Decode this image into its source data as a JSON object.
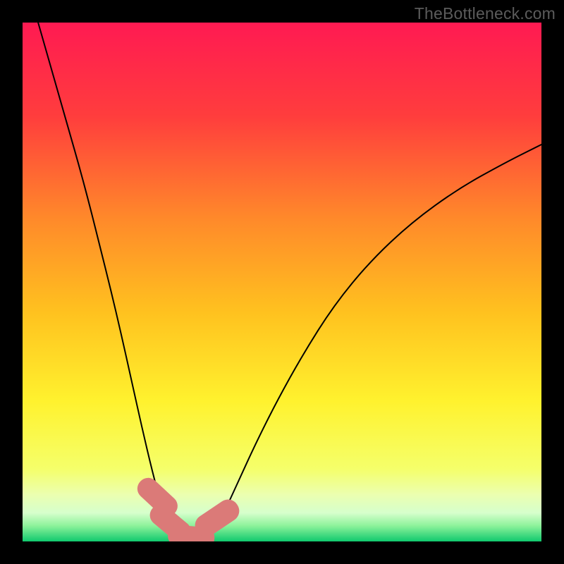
{
  "watermark": "TheBottleneck.com",
  "chart_data": {
    "type": "line",
    "title": "",
    "xlabel": "",
    "ylabel": "",
    "xlim": [
      0,
      100
    ],
    "ylim": [
      0,
      100
    ],
    "grid": false,
    "background_gradient": {
      "stops": [
        {
          "offset": 0.0,
          "color": "#ff1a52"
        },
        {
          "offset": 0.18,
          "color": "#ff3d3d"
        },
        {
          "offset": 0.38,
          "color": "#ff8a2a"
        },
        {
          "offset": 0.56,
          "color": "#ffc21f"
        },
        {
          "offset": 0.73,
          "color": "#fff22e"
        },
        {
          "offset": 0.86,
          "color": "#f5ff6a"
        },
        {
          "offset": 0.91,
          "color": "#ebffb0"
        },
        {
          "offset": 0.945,
          "color": "#d6ffcc"
        },
        {
          "offset": 0.97,
          "color": "#8cf29a"
        },
        {
          "offset": 1.0,
          "color": "#10c96e"
        }
      ]
    },
    "series": [
      {
        "name": "left-branch",
        "x": [
          3,
          5,
          7,
          9,
          11,
          13,
          15,
          17,
          19,
          21,
          23,
          25,
          27,
          28.5,
          29.5
        ],
        "y": [
          100,
          93,
          86,
          79,
          72,
          64.5,
          56.5,
          48.5,
          40,
          31,
          22,
          13.5,
          6,
          2.5,
          0.8
        ]
      },
      {
        "name": "right-branch",
        "x": [
          36,
          37.5,
          39.5,
          42,
          45,
          49,
          54,
          60,
          67,
          75,
          84,
          93,
          100
        ],
        "y": [
          0.8,
          3,
          7,
          12.5,
          19,
          27,
          36,
          45.5,
          54,
          61.5,
          68,
          73,
          76.5
        ]
      }
    ],
    "bottom_flat": {
      "x": [
        29.5,
        36
      ],
      "y": [
        0.8,
        0.8
      ]
    },
    "markers": {
      "name": "bottom-marks",
      "shape": "rounded-rect",
      "color": "#db7a78",
      "points": [
        {
          "cx": 26.0,
          "cy": 8.5,
          "w": 4.1,
          "h": 9.0,
          "rot": -47
        },
        {
          "cx": 28.5,
          "cy": 3.5,
          "w": 4.1,
          "h": 9.0,
          "rot": -50
        },
        {
          "cx": 32.5,
          "cy": 0.9,
          "w": 4.1,
          "h": 9.0,
          "rot": -85
        },
        {
          "cx": 37.5,
          "cy": 4.5,
          "w": 4.3,
          "h": 9.3,
          "rot": -124
        }
      ]
    }
  }
}
